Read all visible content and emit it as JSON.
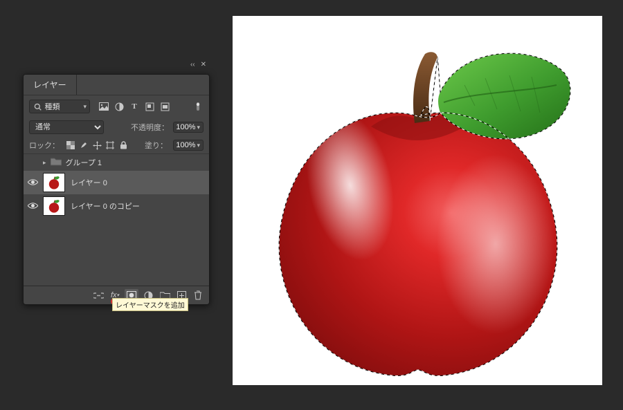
{
  "panel": {
    "title": "レイヤー",
    "collapse_icon": "chevrons-left-icon",
    "close_icon": "close-icon",
    "filter_label": "種類",
    "filter_icons": [
      "image-icon",
      "adjustment-icon",
      "type-icon",
      "shape-icon",
      "smart-object-icon"
    ],
    "toggle_icon": "dot-icon"
  },
  "blend": {
    "mode": "通常",
    "opacity_label": "不透明度：",
    "opacity_value": "100%"
  },
  "lock": {
    "label": "ロック：",
    "icons": [
      "pixel-lock-icon",
      "brush-lock-icon",
      "move-lock-icon",
      "artboard-lock-icon",
      "lock-all-icon"
    ],
    "fill_label": "塗り：",
    "fill_value": "100%"
  },
  "group": {
    "name": "グループ 1"
  },
  "layers": [
    {
      "name": "レイヤー 0",
      "visible": true,
      "selected": true
    },
    {
      "name": "レイヤー 0 のコピー",
      "visible": true,
      "selected": false
    }
  ],
  "footer": {
    "icons": [
      "link-icon",
      "fx-icon",
      "mask-icon",
      "adjustment-layer-icon",
      "group-icon",
      "new-layer-icon",
      "trash-icon"
    ],
    "tooltip": "レイヤーマスクを追加"
  },
  "canvas": {
    "subject": "apple with leaf and marching-ants selection"
  }
}
